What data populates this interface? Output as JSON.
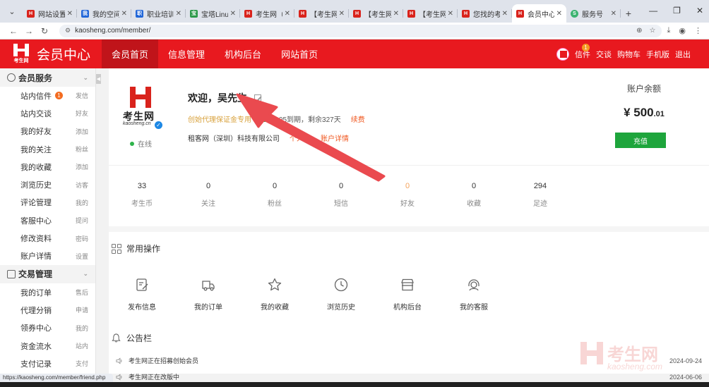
{
  "browser": {
    "tabs": [
      {
        "title": "网站设置 -",
        "fav": "red",
        "ch": "H"
      },
      {
        "title": "我的空间",
        "fav": "blue",
        "ch": "我"
      },
      {
        "title": "职业培训新",
        "fav": "blue",
        "ch": "职"
      },
      {
        "title": "宝塔Linux",
        "fav": "green",
        "ch": "宝"
      },
      {
        "title": "考生网（ka",
        "fav": "red",
        "ch": "H"
      },
      {
        "title": "【考生网】",
        "fav": "red",
        "ch": "H"
      },
      {
        "title": "【考生网】",
        "fav": "red",
        "ch": "H"
      },
      {
        "title": "【考生网】",
        "fav": "red",
        "ch": "H"
      },
      {
        "title": "您找的考生",
        "fav": "red",
        "ch": "H"
      },
      {
        "title": "会员中心_考",
        "fav": "red",
        "ch": "H",
        "active": true
      },
      {
        "title": "服务号",
        "fav": "teal",
        "ch": "S"
      }
    ],
    "url": "kaosheng.com/member/",
    "status_url": "https://kaosheng.com/member/friend.php"
  },
  "header": {
    "logo_text": "考生网",
    "title": "会员中心",
    "nav": [
      {
        "label": "会员首页",
        "active": true
      },
      {
        "label": "信息管理"
      },
      {
        "label": "机构后台"
      },
      {
        "label": "网站首页"
      }
    ],
    "right": {
      "messages": "信件",
      "messages_count": "1",
      "chat": "交谈",
      "cart": "购物车",
      "mobile": "手机版",
      "logout": "退出"
    }
  },
  "sidebar": {
    "sections": [
      {
        "title": "会员服务",
        "items": [
          {
            "label": "站内信件",
            "action": "发信",
            "count": "1"
          },
          {
            "label": "站内交谈",
            "action": "好友"
          },
          {
            "label": "我的好友",
            "action": "添加"
          },
          {
            "label": "我的关注",
            "action": "粉丝"
          },
          {
            "label": "我的收藏",
            "action": "添加"
          },
          {
            "label": "浏览历史",
            "action": "访客"
          },
          {
            "label": "评论管理",
            "action": "我的"
          },
          {
            "label": "客服中心",
            "action": "提问"
          },
          {
            "label": "修改资料",
            "action": "密码"
          },
          {
            "label": "账户详情",
            "action": "设置"
          }
        ]
      },
      {
        "title": "交易管理",
        "items": [
          {
            "label": "我的订单",
            "action": "售后"
          },
          {
            "label": "代理分销",
            "action": "申请"
          },
          {
            "label": "领券中心",
            "action": "我的"
          },
          {
            "label": "资金流水",
            "action": "站内"
          },
          {
            "label": "支付记录",
            "action": "支付"
          }
        ]
      }
    ]
  },
  "profile": {
    "logo_text": "考生网",
    "logo_sub": "kaosheng.cn",
    "online": "在线",
    "welcome": "欢迎，吴先生",
    "grade": "创始代理保证金专用",
    "vip_tag": "VIP",
    "expire": "8-05到期，剩余327天",
    "renew": "续费",
    "company": "租客网（深圳）科技有限公司",
    "link_home": "个人主",
    "link_account": "账户详情"
  },
  "balance": {
    "label": "账户余额",
    "amount_main": "¥ 500",
    "amount_dec": ".01",
    "recharge": "充值"
  },
  "stats": [
    {
      "value": "33",
      "label": "考生币"
    },
    {
      "value": "0",
      "label": "关注"
    },
    {
      "value": "0",
      "label": "粉丝"
    },
    {
      "value": "0",
      "label": "短信"
    },
    {
      "value": "0",
      "label": "好友",
      "highlight": true
    },
    {
      "value": "0",
      "label": "收藏"
    },
    {
      "value": "294",
      "label": "足迹"
    }
  ],
  "ops": {
    "title": "常用操作",
    "items": [
      {
        "label": "发布信息",
        "icon": "edit-doc-icon"
      },
      {
        "label": "我的订单",
        "icon": "truck-icon"
      },
      {
        "label": "我的收藏",
        "icon": "star-icon"
      },
      {
        "label": "浏览历史",
        "icon": "clock-icon"
      },
      {
        "label": "机构后台",
        "icon": "store-icon"
      },
      {
        "label": "我的客服",
        "icon": "headset-icon"
      }
    ]
  },
  "notices": {
    "title": "公告栏",
    "items": [
      {
        "text": "考生网正在招募创始会员",
        "date": "2024-09-24"
      },
      {
        "text": "考生网正在改版中",
        "date": "2024-06-06"
      }
    ]
  },
  "watermark": {
    "text": "考生网",
    "sub": "kaosheng.com"
  },
  "colors": {
    "brand": "#e8191f",
    "accent": "#f05a23",
    "success": "#1ea53c"
  }
}
